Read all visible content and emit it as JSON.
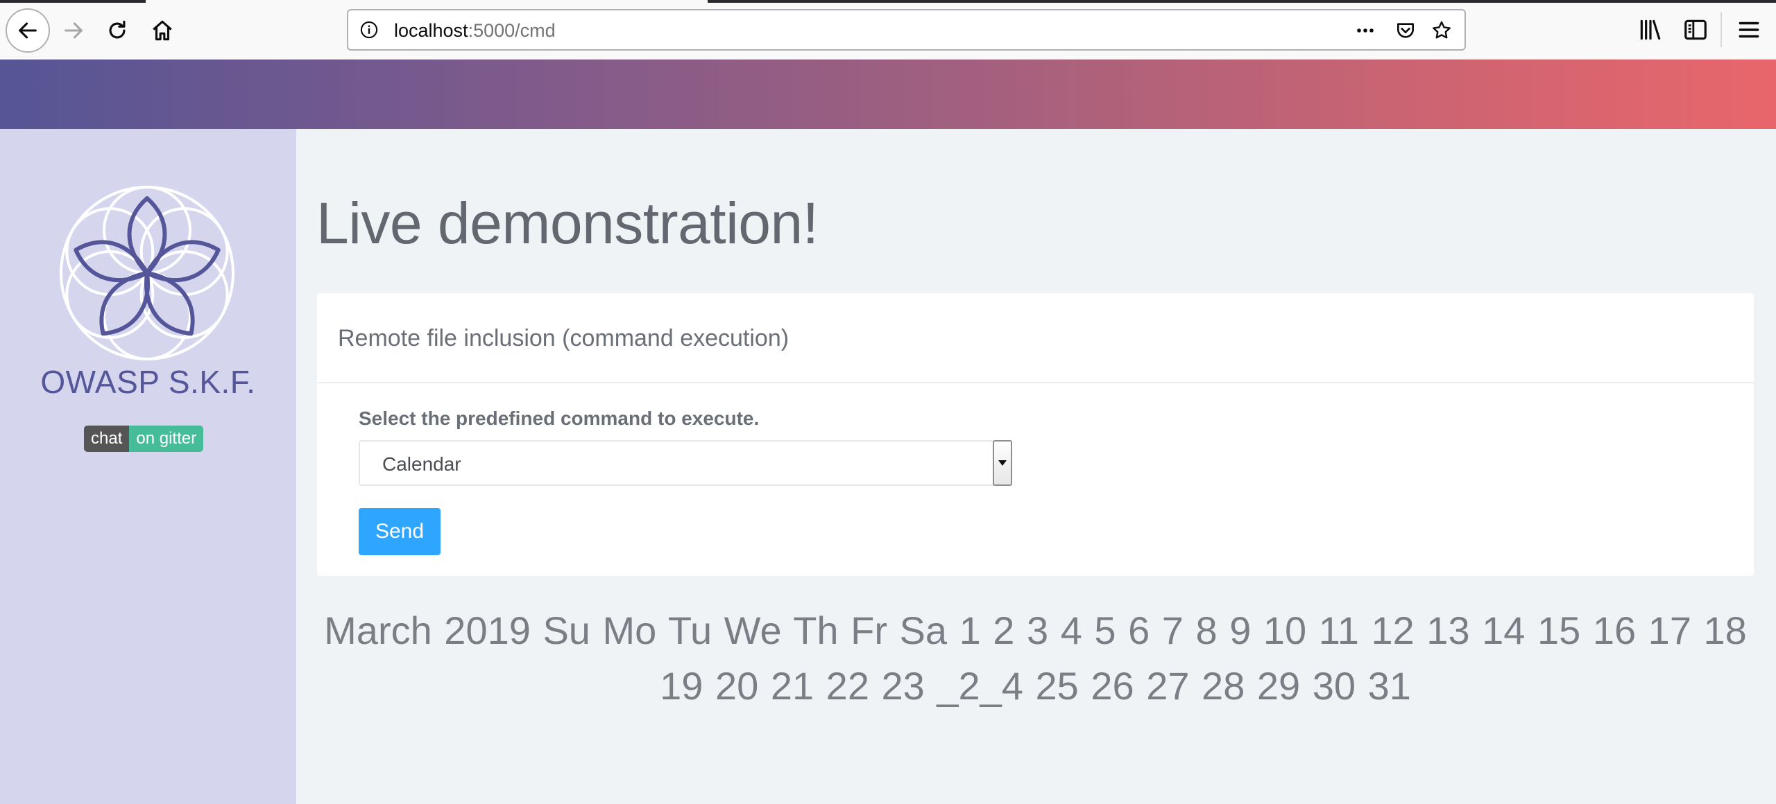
{
  "browser": {
    "url_host": "localhost",
    "url_path": ":5000/cmd",
    "icons": [
      "back-arrow-icon",
      "forward-arrow-icon",
      "reload-icon",
      "home-icon",
      "info-icon",
      "more-icon",
      "pocket-icon",
      "bookmark-star-icon",
      "library-icon",
      "sidebar-icon",
      "menu-icon"
    ]
  },
  "colors": {
    "header_gradient_start": "#565595",
    "header_gradient_end": "#e8666b",
    "sidebar_bg": "#d5d6ee",
    "brand": "#55569a",
    "button": "#2ea5ff",
    "gitter_green": "#46bc99"
  },
  "sidebar": {
    "brand": "OWASP S.K.F.",
    "badge_left": "chat",
    "badge_right": "on gitter"
  },
  "main": {
    "title": "Live demonstration!",
    "card_title": "Remote file inclusion (command execution)",
    "form_label": "Select the predefined command to execute.",
    "selected_command": "Calendar",
    "send_label": "Send",
    "output": "March 2019 Su Mo Tu We Th Fr Sa 1 2 3 4 5 6 7 8 9 10 11 12 13 14 15 16 17 18 19 20 21 22 23 _2_4 25 26 27 28 29 30 31"
  }
}
